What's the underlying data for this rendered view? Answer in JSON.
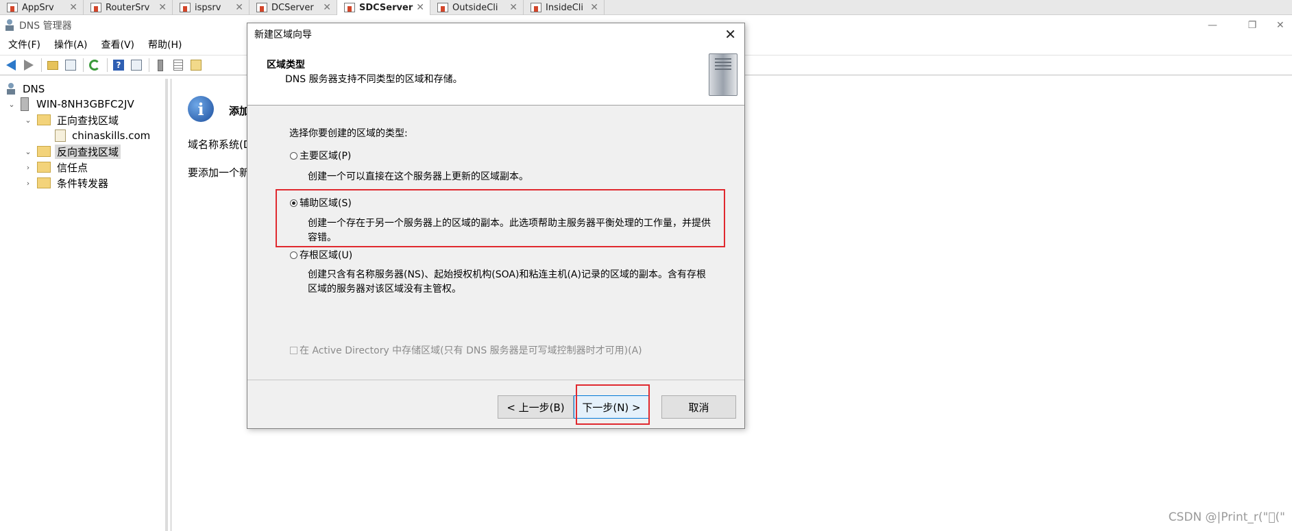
{
  "vm_tabs": [
    {
      "label": "AppSrv",
      "active": false
    },
    {
      "label": "RouterSrv",
      "active": false
    },
    {
      "label": "ispsrv",
      "active": false
    },
    {
      "label": "DCServer",
      "active": false
    },
    {
      "label": "SDCServer",
      "active": true
    },
    {
      "label": "OutsideCli",
      "active": false
    },
    {
      "label": "InsideCli",
      "active": false
    }
  ],
  "window": {
    "title": "DNS 管理器",
    "minimize": "—",
    "restore": "❐",
    "close": "✕"
  },
  "menu": [
    "文件(F)",
    "操作(A)",
    "查看(V)",
    "帮助(H)"
  ],
  "toolbar_icons": [
    "back-icon",
    "forward-icon",
    "up-folder-icon",
    "show-hide-tree-icon",
    "refresh-icon",
    "help-icon",
    "console-icon",
    "server-icon",
    "list-icon",
    "properties-icon"
  ],
  "tree": {
    "root": "DNS",
    "server": "WIN-8NH3GBFC2JV",
    "forward_zone": "正向查找区域",
    "forward_child": "chinaskills.com",
    "reverse_zone": "反向查找区域",
    "trust_points": "信任点",
    "conditional_forwarders": "条件转发器"
  },
  "right_pane": {
    "heading": "添加",
    "line1": "域名称系统(D",
    "line2": "要添加一个新"
  },
  "dialog": {
    "title": "新建区域向导",
    "close": "✕",
    "header_title": "区域类型",
    "header_subtitle": "DNS 服务器支持不同类型的区域和存储。",
    "prompt": "选择你要创建的区域的类型:",
    "options": [
      {
        "label": "主要区域(P)",
        "checked": false,
        "desc": "创建一个可以直接在这个服务器上更新的区域副本。"
      },
      {
        "label": "辅助区域(S)",
        "checked": true,
        "desc": "创建一个存在于另一个服务器上的区域的副本。此选项帮助主服务器平衡处理的工作量，并提供容错。"
      },
      {
        "label": "存根区域(U)",
        "checked": false,
        "desc": "创建只含有名称服务器(NS)、起始授权机构(SOA)和粘连主机(A)记录的区域的副本。含有存根区域的服务器对该区域没有主管权。"
      }
    ],
    "ad_checkbox": "在 Active Directory 中存储区域(只有 DNS 服务器是可写域控制器时才可用)(A)",
    "buttons": {
      "back": "< 上一步(B)",
      "next": "下一步(N) >",
      "cancel": "取消"
    }
  },
  "watermark": "CSDN @|Print_r(\"\u0000(\"",
  "colors": {
    "highlight": "#e0282e",
    "default_button_border": "#0078d7"
  }
}
